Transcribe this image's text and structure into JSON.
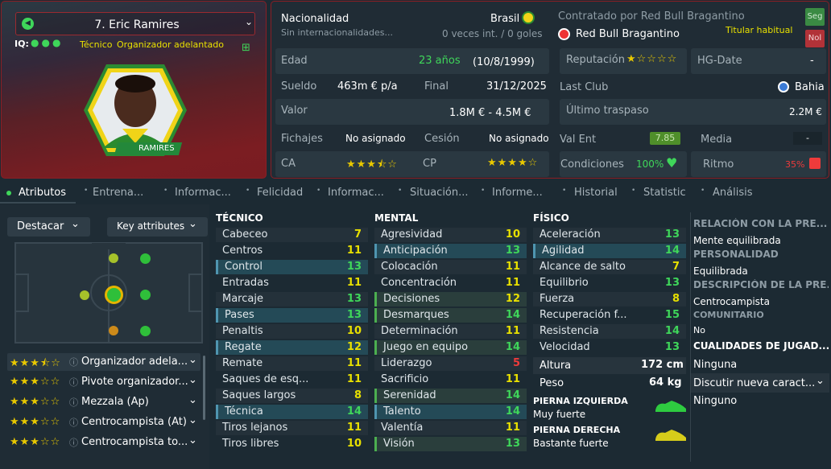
{
  "player": {
    "number_name": "7. Eric Ramires",
    "iq_label": "IQ:",
    "roles_text": "Técnico",
    "role_main": "Organizador adelantado",
    "photo_name": "RAMIRES"
  },
  "nationality": {
    "label": "Nacionalidad",
    "value": "Brasil",
    "caps_label": "Sin internacionalidades...",
    "caps_value": "0 veces int. / 0 goles"
  },
  "contract": {
    "label": "Contratado por Red Bull Bragantino",
    "club": "Red Bull Bragantino",
    "status": "Titular habitual",
    "btn_seg": "Seg",
    "btn_nol": "Nol"
  },
  "age": {
    "label": "Edad",
    "value": "23 años",
    "dob": "(10/8/1999)"
  },
  "wage": {
    "label": "Sueldo",
    "value": "463m € p/a",
    "end_label": "Final",
    "end_value": "31/12/2025"
  },
  "value": {
    "label": "Valor",
    "range": "1.8M € - 4.5M €"
  },
  "transfer": {
    "fichajes_label": "Fichajes",
    "fichajes_value": "No asignado",
    "cesion_label": "Cesión",
    "cesion_value": "No asignado"
  },
  "ca": {
    "label": "CA",
    "stars": "★★★⯪☆"
  },
  "cp": {
    "label": "CP",
    "stars": "★★★★☆"
  },
  "reputation": {
    "label": "Reputación",
    "stars": "★☆☆☆☆",
    "hg_label": "HG-Date",
    "hg_value": "-"
  },
  "last_club": {
    "label": "Last Club",
    "value": "Bahia"
  },
  "last_transfer": {
    "label": "Último traspaso",
    "value": "2.2M €"
  },
  "val_ent": {
    "label": "Val Ent",
    "value": "7.85",
    "media_label": "Media",
    "media_value": "-"
  },
  "condition": {
    "label": "Condiciones",
    "value": "100%",
    "rhythm_label": "Ritmo",
    "rhythm_value": "35%"
  },
  "tabs": [
    "Atributos",
    "Entrena...",
    "Informac...",
    "Felicidad",
    "Informac...",
    "Situación...",
    "Informe...",
    "Historial",
    "Statistic",
    "Análisis"
  ],
  "controls": {
    "destacar": "Destacar",
    "key_attr": "Key attributes"
  },
  "tecnico": {
    "title": "TÉCNICO",
    "items": [
      {
        "name": "Cabeceo",
        "value": "7"
      },
      {
        "name": "Centros",
        "value": "11"
      },
      {
        "name": "Control",
        "value": "13"
      },
      {
        "name": "Entradas",
        "value": "11"
      },
      {
        "name": "Marcaje",
        "value": "13"
      },
      {
        "name": "Pases",
        "value": "13"
      },
      {
        "name": "Penaltis",
        "value": "10"
      },
      {
        "name": "Regate",
        "value": "12"
      },
      {
        "name": "Remate",
        "value": "11"
      },
      {
        "name": "Saques de esq...",
        "value": "11"
      },
      {
        "name": "Saques largos",
        "value": "8"
      },
      {
        "name": "Técnica",
        "value": "14"
      },
      {
        "name": "Tiros lejanos",
        "value": "11"
      },
      {
        "name": "Tiros libres",
        "value": "10"
      }
    ]
  },
  "mental": {
    "title": "MENTAL",
    "items": [
      {
        "name": "Agresividad",
        "value": "10"
      },
      {
        "name": "Anticipación",
        "value": "13"
      },
      {
        "name": "Colocación",
        "value": "11"
      },
      {
        "name": "Concentración",
        "value": "11"
      },
      {
        "name": "Decisiones",
        "value": "12"
      },
      {
        "name": "Desmarques",
        "value": "14"
      },
      {
        "name": "Determinación",
        "value": "11"
      },
      {
        "name": "Juego en equipo",
        "value": "14"
      },
      {
        "name": "Liderazgo",
        "value": "5"
      },
      {
        "name": "Sacrificio",
        "value": "11"
      },
      {
        "name": "Serenidad",
        "value": "14"
      },
      {
        "name": "Talento",
        "value": "14"
      },
      {
        "name": "Valentía",
        "value": "11"
      },
      {
        "name": "Visión",
        "value": "13"
      }
    ]
  },
  "fisico": {
    "title": "FÍSICO",
    "items": [
      {
        "name": "Aceleración",
        "value": "13"
      },
      {
        "name": "Agilidad",
        "value": "14"
      },
      {
        "name": "Alcance de salto",
        "value": "7"
      },
      {
        "name": "Equilibrio",
        "value": "13"
      },
      {
        "name": "Fuerza",
        "value": "8"
      },
      {
        "name": "Recuperación f...",
        "value": "15"
      },
      {
        "name": "Resistencia",
        "value": "14"
      },
      {
        "name": "Velocidad",
        "value": "13"
      }
    ]
  },
  "body": {
    "height_label": "Altura",
    "height_value": "172 cm",
    "weight_label": "Peso",
    "weight_value": "64 kg",
    "left_foot_label": "PIERNA IZQUIERDA",
    "left_foot_value": "Muy fuerte",
    "right_foot_label": "PIERNA DERECHA",
    "right_foot_value": "Bastante fuerte"
  },
  "right_panel": {
    "h1": "RELACIÓN CON LA PRE...",
    "t1": "Mente equilibrada",
    "h2": "PERSONALIDAD",
    "t2": "Equilibrada",
    "h3": "DESCRIPCIÓN DE LA PRE...",
    "t3": "Centrocampista",
    "h4": "COMUNITARIO",
    "t4": "No",
    "h5": "CUALIDADES DE JUGAD...",
    "t5": "Ninguna",
    "t6": "Discutir nueva caract...",
    "t7": "Ninguno"
  },
  "roles": [
    {
      "stars": "★★★⯪☆",
      "name": "Organizador adela..."
    },
    {
      "stars": "★★★☆☆",
      "name": "Pivote organizador..."
    },
    {
      "stars": "★★★☆☆",
      "name": "Mezzala (Ap)"
    },
    {
      "stars": "★★★☆☆",
      "name": "Centrocampista (At)"
    },
    {
      "stars": "★★★☆☆",
      "name": "Centrocampista to..."
    }
  ],
  "colors": {
    "accent_red": "#8b1e24",
    "attr_green": "#3fd65a",
    "attr_yellow": "#e8e000",
    "attr_red": "#ee3b3b"
  }
}
